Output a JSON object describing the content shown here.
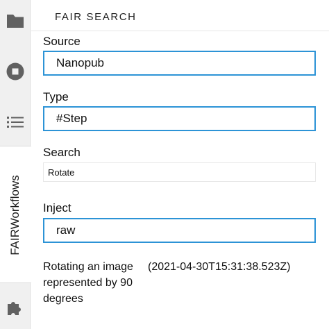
{
  "sidebar": {
    "tabs": [
      {
        "name": "folder",
        "icon": "folder-icon"
      },
      {
        "name": "running",
        "icon": "stop-circle-icon"
      },
      {
        "name": "table-of-contents",
        "icon": "list-icon"
      },
      {
        "name": "extensions",
        "icon": "puzzle-icon"
      }
    ],
    "active_tab_label": "FAIRWorkflows"
  },
  "panel": {
    "title": "FAIR SEARCH",
    "source": {
      "label": "Source",
      "value": "Nanopub"
    },
    "type": {
      "label": "Type",
      "value": "#Step"
    },
    "search": {
      "label": "Search",
      "value": "Rotate"
    },
    "inject": {
      "label": "Inject",
      "value": "raw"
    },
    "result": {
      "description": "Rotating an image represented by 90 degrees",
      "timestamp": "(2021-04-30T15:31:38.523Z)"
    }
  },
  "colors": {
    "accent": "#2c93d6",
    "icon": "#616161",
    "sidebar_bg": "#f0f0f0"
  }
}
